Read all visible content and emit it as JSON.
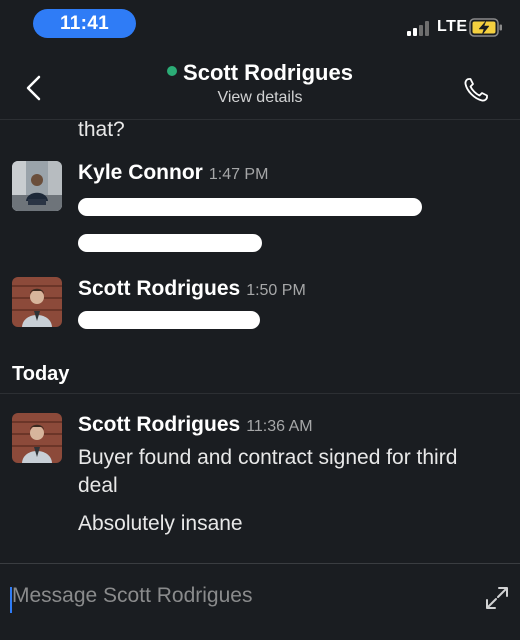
{
  "status_bar": {
    "time": "11:41",
    "network": "LTE"
  },
  "header": {
    "name": "Scott Rodrigues",
    "subtitle": "View details",
    "presence": "online",
    "icons": [
      "back-chevron-icon",
      "phone-icon"
    ]
  },
  "messages": {
    "continuation_text": "that?",
    "kyle": {
      "sender": "Kyle Connor",
      "time": "1:47 PM"
    },
    "scott_1": {
      "sender": "Scott Rodrigues",
      "time": "1:50 PM"
    },
    "day_divider": "Today",
    "scott_2": {
      "sender": "Scott Rodrigues",
      "time": "11:36 AM",
      "lines": [
        "Buyer found and contract signed for third",
        "deal",
        "Absolutely insane"
      ]
    }
  },
  "composer": {
    "placeholder": "Message Scott Rodrigues"
  },
  "colors": {
    "background": "#1a1d21",
    "presence": "#2bac76",
    "accent": "#2f7cf6",
    "battery_charge": "#f4d03f"
  }
}
